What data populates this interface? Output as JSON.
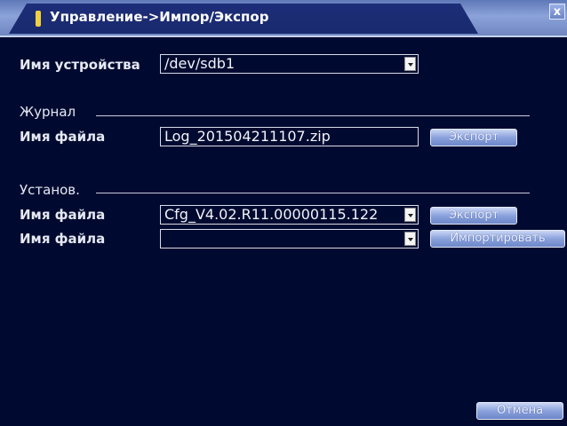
{
  "window": {
    "title": "Управление->Импор/Экспор",
    "close_glyph": "x"
  },
  "device": {
    "label": "Имя устройства",
    "value": "/dev/sdb1"
  },
  "journal": {
    "section_label": "Журнал",
    "file_label": "Имя файла",
    "file_value": "Log_201504211107.zip",
    "export_button": "Экспорт"
  },
  "settings": {
    "section_label": "Установ.",
    "file1_label": "Имя файла",
    "file1_value": "Cfg_V4.02.R11.00000115.122",
    "export_button": "Экспорт",
    "file2_label": "Имя файла",
    "file2_value": "",
    "import_button": "Импортировать"
  },
  "footer": {
    "cancel_button": "Отмена"
  }
}
